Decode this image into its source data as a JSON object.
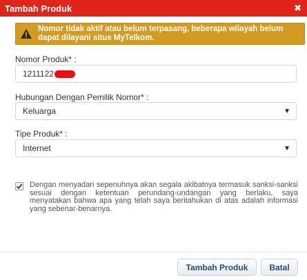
{
  "dialog": {
    "title": "Tambah Produk",
    "close_symbol": "✖"
  },
  "alert": {
    "icon": "warning-icon",
    "message": "Nomor tidak aktif atau belum terpasang, beberapa wilayah belum dapat dilayani situs MyTelkom."
  },
  "form": {
    "nomor_produk": {
      "label": "Nomor Produk* :",
      "value": "1211122"
    },
    "hubungan": {
      "label": "Hubungan Dengan Pemilik Nomor* :",
      "selected": "Keluarga"
    },
    "tipe_produk": {
      "label": "Tipe Produk* :",
      "selected": "Internet"
    },
    "consent": {
      "checked": true,
      "text": "Dengan menyadari sepenuhnya akan segala akibatnya termasuk sanksi-sanksi sesuai dengan ketentuan perundang-undangan yang berlaku, saya menyatakan bahwa apa yang telah saya beritahukan di atas adalah informasi yang sebenar-benarnya."
    }
  },
  "buttons": {
    "submit": "Tambah Produk",
    "cancel": "Batal"
  },
  "colors": {
    "titlebar": "#e0251b",
    "alert": "#d39b22",
    "button_text": "#2a4d6e"
  }
}
